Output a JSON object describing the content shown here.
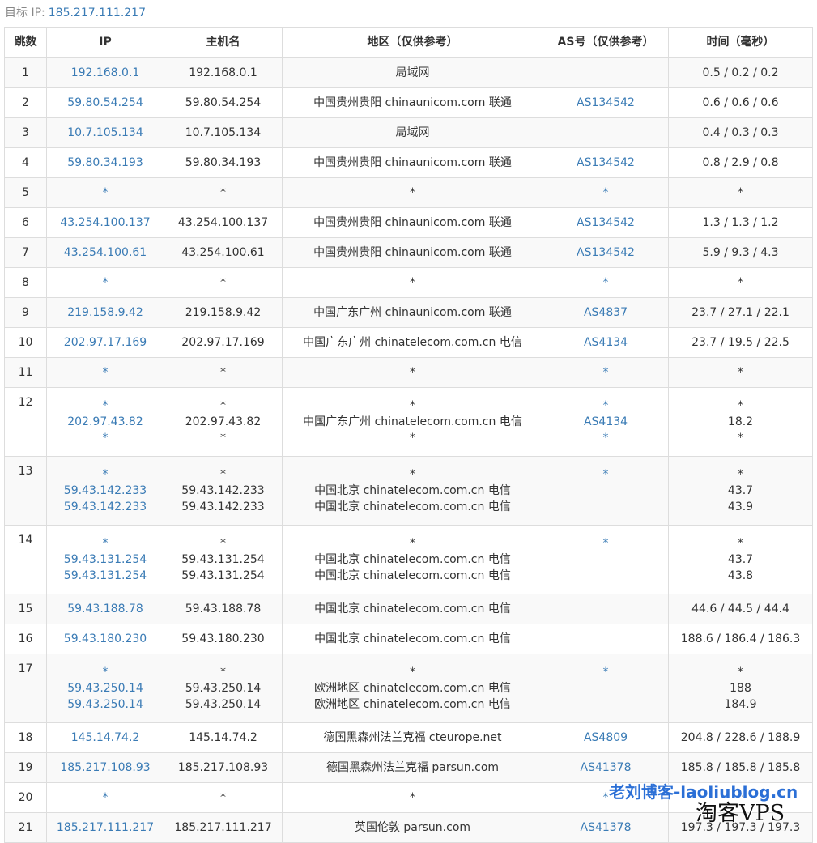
{
  "header": {
    "target_label": "目标 IP:",
    "target_ip": "185.217.111.217"
  },
  "columns": [
    "跳数",
    "IP",
    "主机名",
    "地区（仅供参考）",
    "AS号（仅供参考）",
    "时间（毫秒）"
  ],
  "hops": [
    {
      "hop": "1",
      "ip": [
        "192.168.0.1"
      ],
      "host": [
        "192.168.0.1"
      ],
      "region": [
        "局域网"
      ],
      "as": [
        ""
      ],
      "time": [
        "0.5 / 0.2 / 0.2"
      ]
    },
    {
      "hop": "2",
      "ip": [
        "59.80.54.254"
      ],
      "host": [
        "59.80.54.254"
      ],
      "region": [
        "中国贵州贵阳 chinaunicom.com 联通"
      ],
      "as": [
        "AS134542"
      ],
      "time": [
        "0.6 / 0.6 / 0.6"
      ]
    },
    {
      "hop": "3",
      "ip": [
        "10.7.105.134"
      ],
      "host": [
        "10.7.105.134"
      ],
      "region": [
        "局域网"
      ],
      "as": [
        ""
      ],
      "time": [
        "0.4 / 0.3 / 0.3"
      ]
    },
    {
      "hop": "4",
      "ip": [
        "59.80.34.193"
      ],
      "host": [
        "59.80.34.193"
      ],
      "region": [
        "中国贵州贵阳 chinaunicom.com 联通"
      ],
      "as": [
        "AS134542"
      ],
      "time": [
        "0.8 / 2.9 / 0.8"
      ]
    },
    {
      "hop": "5",
      "ip": [
        "*"
      ],
      "host": [
        "*"
      ],
      "region": [
        "*"
      ],
      "as": [
        "*"
      ],
      "time": [
        "*"
      ]
    },
    {
      "hop": "6",
      "ip": [
        "43.254.100.137"
      ],
      "host": [
        "43.254.100.137"
      ],
      "region": [
        "中国贵州贵阳 chinaunicom.com 联通"
      ],
      "as": [
        "AS134542"
      ],
      "time": [
        "1.3 / 1.3 / 1.2"
      ]
    },
    {
      "hop": "7",
      "ip": [
        "43.254.100.61"
      ],
      "host": [
        "43.254.100.61"
      ],
      "region": [
        "中国贵州贵阳 chinaunicom.com 联通"
      ],
      "as": [
        "AS134542"
      ],
      "time": [
        "5.9 / 9.3 / 4.3"
      ]
    },
    {
      "hop": "8",
      "ip": [
        "*"
      ],
      "host": [
        "*"
      ],
      "region": [
        "*"
      ],
      "as": [
        "*"
      ],
      "time": [
        "*"
      ]
    },
    {
      "hop": "9",
      "ip": [
        "219.158.9.42"
      ],
      "host": [
        "219.158.9.42"
      ],
      "region": [
        "中国广东广州 chinaunicom.com 联通"
      ],
      "as": [
        "AS4837"
      ],
      "time": [
        "23.7 / 27.1 / 22.1"
      ]
    },
    {
      "hop": "10",
      "ip": [
        "202.97.17.169"
      ],
      "host": [
        "202.97.17.169"
      ],
      "region": [
        "中国广东广州 chinatelecom.com.cn 电信"
      ],
      "as": [
        "AS4134"
      ],
      "time": [
        "23.7 / 19.5 / 22.5"
      ]
    },
    {
      "hop": "11",
      "ip": [
        "*"
      ],
      "host": [
        "*"
      ],
      "region": [
        "*"
      ],
      "as": [
        "*"
      ],
      "time": [
        "*"
      ]
    },
    {
      "hop": "12",
      "ip": [
        "*",
        "202.97.43.82",
        "*"
      ],
      "host": [
        "*",
        "202.97.43.82",
        "*"
      ],
      "region": [
        "*",
        "中国广东广州 chinatelecom.com.cn 电信",
        "*"
      ],
      "as": [
        "*",
        "AS4134",
        "*"
      ],
      "time": [
        "*",
        "18.2",
        "*"
      ]
    },
    {
      "hop": "13",
      "ip": [
        "*",
        "59.43.142.233",
        "59.43.142.233"
      ],
      "host": [
        "*",
        "59.43.142.233",
        "59.43.142.233"
      ],
      "region": [
        "*",
        "中国北京 chinatelecom.com.cn 电信",
        "中国北京 chinatelecom.com.cn 电信"
      ],
      "as": [
        "*",
        "",
        ""
      ],
      "time": [
        "*",
        "43.7",
        "43.9"
      ]
    },
    {
      "hop": "14",
      "ip": [
        "*",
        "59.43.131.254",
        "59.43.131.254"
      ],
      "host": [
        "*",
        "59.43.131.254",
        "59.43.131.254"
      ],
      "region": [
        "*",
        "中国北京 chinatelecom.com.cn 电信",
        "中国北京 chinatelecom.com.cn 电信"
      ],
      "as": [
        "*",
        "",
        ""
      ],
      "time": [
        "*",
        "43.7",
        "43.8"
      ]
    },
    {
      "hop": "15",
      "ip": [
        "59.43.188.78"
      ],
      "host": [
        "59.43.188.78"
      ],
      "region": [
        "中国北京 chinatelecom.com.cn 电信"
      ],
      "as": [
        ""
      ],
      "time": [
        "44.6 / 44.5 / 44.4"
      ]
    },
    {
      "hop": "16",
      "ip": [
        "59.43.180.230"
      ],
      "host": [
        "59.43.180.230"
      ],
      "region": [
        "中国北京 chinatelecom.com.cn 电信"
      ],
      "as": [
        ""
      ],
      "time": [
        "188.6 / 186.4 / 186.3"
      ]
    },
    {
      "hop": "17",
      "ip": [
        "*",
        "59.43.250.14",
        "59.43.250.14"
      ],
      "host": [
        "*",
        "59.43.250.14",
        "59.43.250.14"
      ],
      "region": [
        "*",
        "欧洲地区 chinatelecom.com.cn 电信",
        "欧洲地区 chinatelecom.com.cn 电信"
      ],
      "as": [
        "*",
        "",
        ""
      ],
      "time": [
        "*",
        "188",
        "184.9"
      ]
    },
    {
      "hop": "18",
      "ip": [
        "145.14.74.2"
      ],
      "host": [
        "145.14.74.2"
      ],
      "region": [
        "德国黑森州法兰克福 cteurope.net"
      ],
      "as": [
        "AS4809"
      ],
      "time": [
        "204.8 / 228.6 / 188.9"
      ]
    },
    {
      "hop": "19",
      "ip": [
        "185.217.108.93"
      ],
      "host": [
        "185.217.108.93"
      ],
      "region": [
        "德国黑森州法兰克福 parsun.com"
      ],
      "as": [
        "AS41378"
      ],
      "time": [
        "185.8 / 185.8 / 185.8"
      ]
    },
    {
      "hop": "20",
      "ip": [
        "*"
      ],
      "host": [
        "*"
      ],
      "region": [
        "*"
      ],
      "as": [
        "*"
      ],
      "time": [
        "*"
      ]
    },
    {
      "hop": "21",
      "ip": [
        "185.217.111.217"
      ],
      "host": [
        "185.217.111.217"
      ],
      "region": [
        "英国伦敦 parsun.com"
      ],
      "as": [
        "AS41378"
      ],
      "time": [
        "197.3 / 197.3 / 197.3"
      ]
    }
  ],
  "watermarks": {
    "blog": "老刘博客-laoliublog.cn",
    "site": "淘客VPS"
  },
  "colors": {
    "link": "#3a7bb5",
    "border": "#dddddd",
    "stripe": "#f9f9f9",
    "watermark_blue": "#2b6fd6"
  }
}
